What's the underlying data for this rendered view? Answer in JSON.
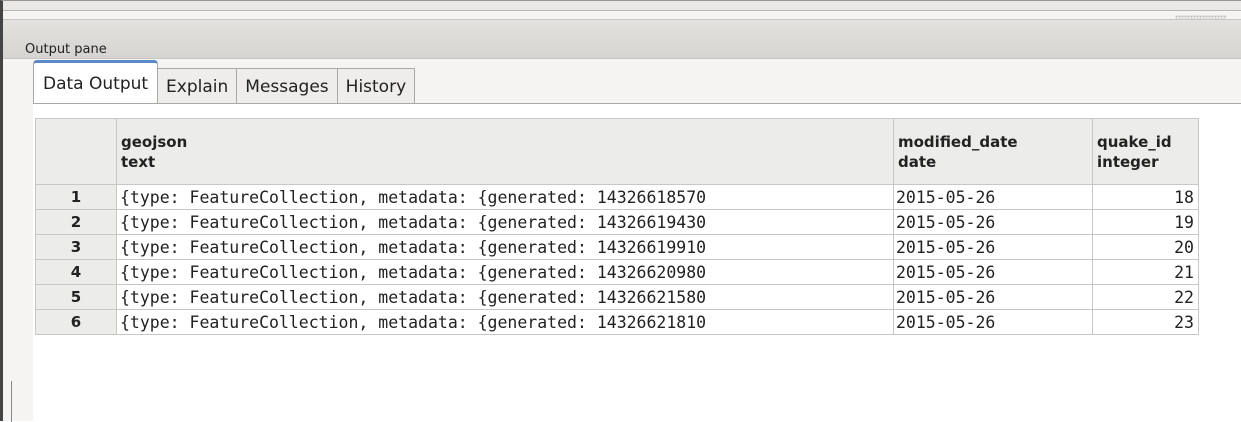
{
  "pane": {
    "title": "Output pane"
  },
  "tabs": [
    {
      "label": "Data Output",
      "active": true
    },
    {
      "label": "Explain",
      "active": false
    },
    {
      "label": "Messages",
      "active": false
    },
    {
      "label": "History",
      "active": false
    }
  ],
  "grid": {
    "columns": [
      {
        "name": "geojson",
        "type": "text"
      },
      {
        "name": "modified_date",
        "type": "date"
      },
      {
        "name": "quake_id",
        "type": "integer"
      }
    ],
    "rows": [
      {
        "num": "1",
        "geojson": "{type: FeatureCollection, metadata: {generated: 14326618570",
        "modified_date": "2015-05-26",
        "quake_id": "18"
      },
      {
        "num": "2",
        "geojson": "{type: FeatureCollection, metadata: {generated: 14326619430",
        "modified_date": "2015-05-26",
        "quake_id": "19"
      },
      {
        "num": "3",
        "geojson": "{type: FeatureCollection, metadata: {generated: 14326619910",
        "modified_date": "2015-05-26",
        "quake_id": "20"
      },
      {
        "num": "4",
        "geojson": "{type: FeatureCollection, metadata: {generated: 14326620980",
        "modified_date": "2015-05-26",
        "quake_id": "21"
      },
      {
        "num": "5",
        "geojson": "{type: FeatureCollection, metadata: {generated: 14326621580",
        "modified_date": "2015-05-26",
        "quake_id": "22"
      },
      {
        "num": "6",
        "geojson": "{type: FeatureCollection, metadata: {generated: 14326621810",
        "modified_date": "2015-05-26",
        "quake_id": "23"
      }
    ]
  },
  "colors": {
    "active_tab_accent": "#5b89c8",
    "header_bg": "#ececea"
  }
}
